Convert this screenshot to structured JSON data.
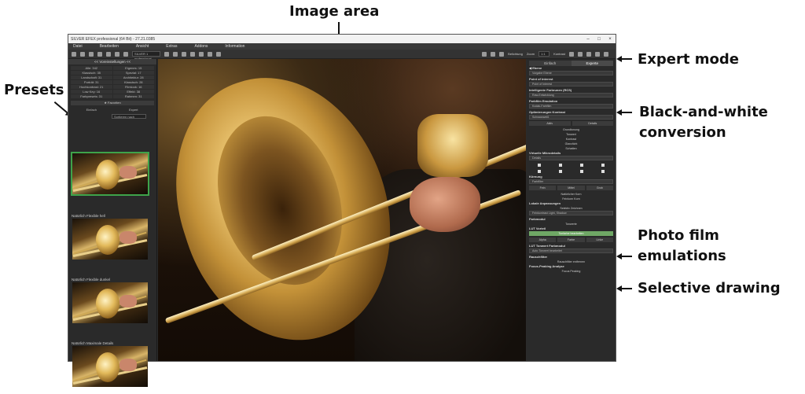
{
  "annotations": {
    "image_area": "Image area",
    "presets": "Presets",
    "expert_mode": "Expert mode",
    "bw_conversion_line1": "Black-and-white",
    "bw_conversion_line2": "conversion",
    "photo_film_line1": "Photo film",
    "photo_film_line2": "emulations",
    "selective_drawing": "Selective drawing"
  },
  "window": {
    "title": "SILVER EFEX professional (64 Bit) - 27.21.0385",
    "min": "–",
    "max": "□",
    "close": "×"
  },
  "menu": [
    "Datei",
    "Bearbeiten",
    "Ansicht",
    "Extras",
    "Addons",
    "Information"
  ],
  "toolbar": {
    "profile_select": "SILVER 1 professional",
    "zoom_label": "Zoom",
    "zoom_value": "1:1",
    "exposure_label": "Belichtung",
    "contrast_label": "Kontrast"
  },
  "left": {
    "header": "<< Voreinstellungen <<",
    "categories": [
      "Alle: 342",
      "Eigenes: 15",
      "Klassisch: 35",
      "Spezial: 17",
      "Landschaft: 31",
      "Architektur: 28",
      "Porträt: 31",
      "Klassisch: 28",
      "Hochkontrast: 21",
      "Filmlook: 16",
      "Low Key: 16",
      "Effekt: 38",
      "Farbpresets: 31",
      "Rahmen: 31"
    ],
    "favorites": "★ Favoriten",
    "mode_simple": "Einfach",
    "mode_expert": "Expert",
    "sort": "Sortieren nach",
    "presets": [
      {
        "label": ""
      },
      {
        "label": "Natürlich Flexible hell"
      },
      {
        "label": "Natürlich Flexible dunkel"
      },
      {
        "label": "Natürlich Maximale Details"
      }
    ]
  },
  "right": {
    "tab_simple": "Einfach",
    "tab_expert": "Experte",
    "section_layer": "◀ Ebene",
    "layer_value": "Vorgabe Ebene",
    "section_pov": "Point of Interest",
    "pov_value": "Point of Interest",
    "section_raw": "Intelligente Farbrunen (RCS)",
    "raw_value": "Raw-Entwicklung",
    "section_film": "Farbfilm Emulation",
    "film_value": "Kodak-Farbfilm",
    "section_bw": "Optimierungen Kontrast",
    "bw_value": "Schwarzweiß",
    "bw_tab1": "Aktiv",
    "bw_tab2": "Details",
    "bw_options": [
      "Grundtonung",
      "Tonwert",
      "Kontrast",
      "Glanzlicht",
      "Schatten"
    ],
    "section_micro": "Virtuelle Mikrodetails",
    "micro_value": "Details",
    "section_color": "Körnung",
    "color_value": "Farbfilter",
    "grain_tabs": [
      "Fein",
      "Mittel",
      "Grob"
    ],
    "grain_buttons": [
      "Natürlicher Korn",
      "Feinkorn Korn"
    ],
    "section_selective": "Lokale Anpassungen",
    "selective_value": "Selektiv Zeichnen",
    "fine_value": "Feinkontrast Light, Shadow",
    "section_tone": "Farbmodul",
    "tone_value": "Tonwerte",
    "section_lut": "LUT Vorteil",
    "lut_button": "Tonfarbe bearbeiten",
    "lut_opts": [
      "Alpha",
      "Farbe",
      "Linke"
    ],
    "section_lut2": "LUT Tonwert Farbmodul",
    "lut2_value": "Auto Tonwert bearbeitet",
    "section_noise": "Rauschfilter",
    "noise_value": "Rauschfilter entfernen",
    "section_focus": "Focus-Peaking Analyse",
    "focus_value": "Focus Peaking"
  }
}
